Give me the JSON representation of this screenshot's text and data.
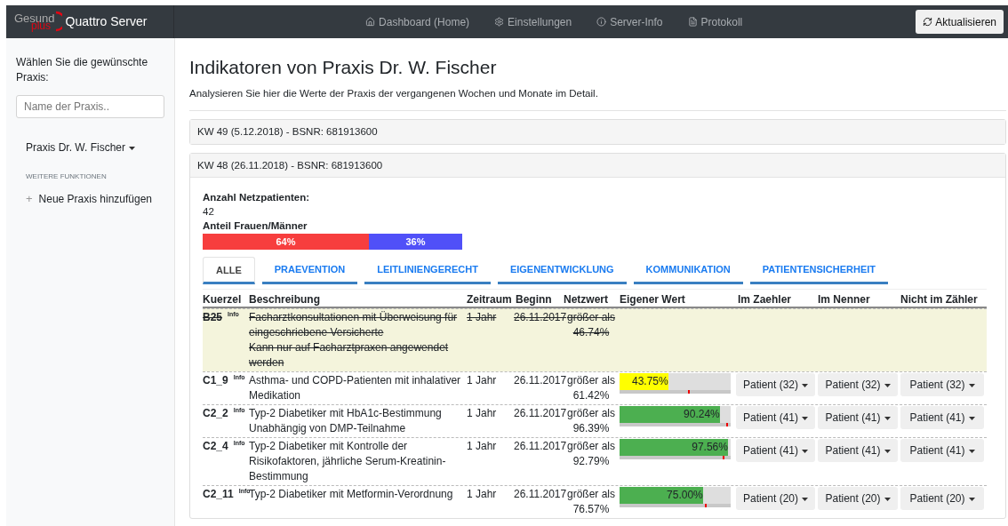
{
  "brand": {
    "logo_top": "Gesund",
    "logo_bottom": "plus",
    "title": "Quattro Server"
  },
  "nav": [
    {
      "label": "Dashboard (Home)"
    },
    {
      "label": "Einstellungen"
    },
    {
      "label": "Server-Info"
    },
    {
      "label": "Protokoll"
    }
  ],
  "refresh_button": "Aktualisieren",
  "sidebar": {
    "prompt": "Wählen Sie die gewünschte Praxis:",
    "search": {
      "placeholder": "Name der Praxis.."
    },
    "practice": "Praxis Dr. W. Fischer",
    "section": "WEITERE FUNKTIONEN",
    "add": {
      "icon": "+",
      "label": "Neue Praxis hinzufügen"
    }
  },
  "page": {
    "title": "Indikatoren von Praxis Dr. W. Fischer",
    "subtitle": "Analysieren Sie hier die Werte der Praxis der vergangenen Wochen und Monate im Detail."
  },
  "weeks": [
    {
      "header": "KW 49 (5.12.2018) - BSNR: 681913600",
      "expanded": false
    },
    {
      "header": "KW 48 (26.11.2018) - BSNR: 681913600",
      "expanded": true
    }
  ],
  "summary": {
    "patients_label": "Anzahl Netzpatienten:",
    "patients": "42",
    "ratio_label": "Anteil Frauen/Männer",
    "ratio": {
      "women": {
        "label": "64%",
        "level": 0.64,
        "color": "#f73e3e"
      },
      "men": {
        "label": "36%",
        "color": "#5050f8"
      }
    }
  },
  "tabs": [
    {
      "label": "ALLE",
      "selected": true
    },
    {
      "label": "PRAEVENTION",
      "selected": false
    },
    {
      "label": "LEITLINIENGERECHT",
      "selected": false
    },
    {
      "label": "EIGENENTWICKLUNG",
      "selected": false
    },
    {
      "label": "KOMMUNIKATION",
      "selected": false
    },
    {
      "label": "PATIENTENSICHERHEIT",
      "selected": false
    }
  ],
  "table": {
    "columns": [
      "Kuerzel",
      "Beschreibung",
      "Zeitraum",
      "Beginn",
      "Netzwert",
      "Eigener Wert",
      "Im Zaehler",
      "Im Nenner",
      "Nicht im Zähler"
    ],
    "rows": [
      {
        "code": "B25",
        "info": "Info",
        "description": [
          "Facharztkonsultationen mit Überweisung für eingeschriebene Versicherte",
          "Kann nur auf Facharztpraxen angewendet werden"
        ],
        "period": "1 Jahr",
        "start": "26.11.2017",
        "net": "größer als 46.74%",
        "disabled": true
      },
      {
        "code": "C1_9",
        "info": "Info",
        "description": [
          "Asthma- und COPD-Patienten mit inhalativer Medikation"
        ],
        "period": "1 Jahr",
        "start": "26.11.2017",
        "net": "größer als 61.42%",
        "disabled": false,
        "own": {
          "label": "43.75%",
          "level": 0.4375,
          "color": "#ffff00",
          "target": {
            "level": 0.6142
          }
        },
        "buttons": [
          "Patient (32)",
          "Patient (32)",
          "Patient (32)"
        ]
      },
      {
        "code": "C2_2",
        "info": "Info",
        "description": [
          "Typ-2 Diabetiker mit HbA1c-Bestimmung Unabhängig von DMP-Teilnahme"
        ],
        "period": "1 Jahr",
        "start": "26.11.2017",
        "net": "größer als 96.39%",
        "disabled": false,
        "own": {
          "label": "90.24%",
          "level": 0.9024,
          "color": "#4caf50",
          "target": {
            "level": 0.9639
          }
        },
        "buttons": [
          "Patient (41)",
          "Patient (41)",
          "Patient (41)"
        ]
      },
      {
        "code": "C2_4",
        "info": "Info",
        "description": [
          "Typ-2 Diabetiker mit Kontrolle der Risikofaktoren, jährliche Serum-Kreatinin-Bestimmung"
        ],
        "period": "1 Jahr",
        "start": "26.11.2017",
        "net": "größer als 92.79%",
        "disabled": false,
        "own": {
          "label": "97.56%",
          "level": 0.9756,
          "color": "#4caf50",
          "target": {
            "level": 0.9279
          }
        },
        "buttons": [
          "Patient (41)",
          "Patient (41)",
          "Patient (41)"
        ]
      },
      {
        "code": "C2_11",
        "info": "Info",
        "description": [
          "Typ-2 Diabetiker mit Metformin-Verordnung"
        ],
        "period": "1 Jahr",
        "start": "26.11.2017",
        "net": "größer als 76.57%",
        "disabled": false,
        "own": {
          "label": "75.00%",
          "level": 0.75,
          "color": "#4caf50",
          "target": {
            "level": 0.7657
          }
        },
        "buttons": [
          "Patient (20)",
          "Patient (20)",
          "Patient (20)"
        ]
      }
    ]
  }
}
